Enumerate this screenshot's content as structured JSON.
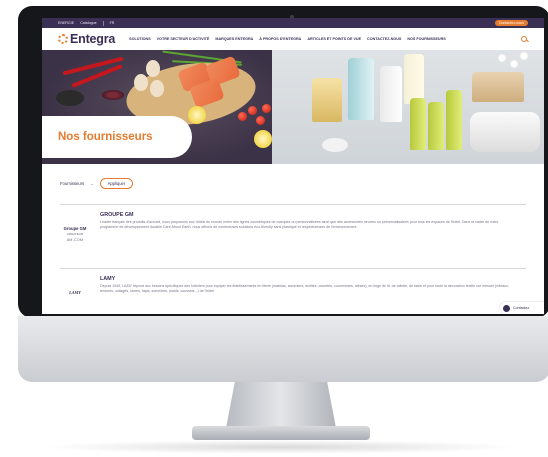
{
  "topbar": {
    "items": [
      "ENERGIE",
      "Catalogue",
      "FR"
    ],
    "contact_label": "Contactez-nous"
  },
  "nav": {
    "logo_text": "Entegra",
    "menu": [
      "SOLUTIONS",
      "VOTRE SECTEUR D'ACTIVITÉ",
      "MARQUES ENTEGRA",
      "À PROPOS D'ENTEGRA",
      "ARTICLES ET POINTS DE VUE",
      "CONTACTEZ-NOUS",
      "NOS FOURNISSEURS"
    ]
  },
  "hero": {
    "title": "Nos fournisseurs"
  },
  "filter": {
    "label": "Fournisseurs",
    "apply_label": "Appliquer"
  },
  "suppliers": [
    {
      "logo_line1": "Groupe GM",
      "logo_line2": "CREATEUR",
      "logo_line3": "AM.COM",
      "name": "GROUPE GM",
      "description": "Leader français des produits d'accueil, nous proposons aux hôtels du monde entier des lignes cosmétiques de marques ou personnalisées ainsi que des accessoires neutres ou personnalisables pour tous les espaces de l'hôtel. Dans le cadre de notre programme de développement durable Care About Earth, nous offrons de nombreuses solutions éco-friendly sans plastique et respectueuses de l'environnement."
    },
    {
      "logo_line1": "LAMY",
      "logo_line2": "",
      "logo_line3": "",
      "name": "LAMY",
      "description": "Depuis 1949, LAMY répond aux besoins spécifiques des hôteliers pour équiper les établissements en literie (matelas, sommiers, textiles, couettes, couvertures, alèses), en linge de lit, de toilette, de table et pour toute la décoration textile sur mesure (rideaux, tentures, voilages, stores, tapis, sommiers, plaids, coussins...) de l'hôtel"
    }
  ],
  "chat": {
    "label": "Contactez"
  }
}
